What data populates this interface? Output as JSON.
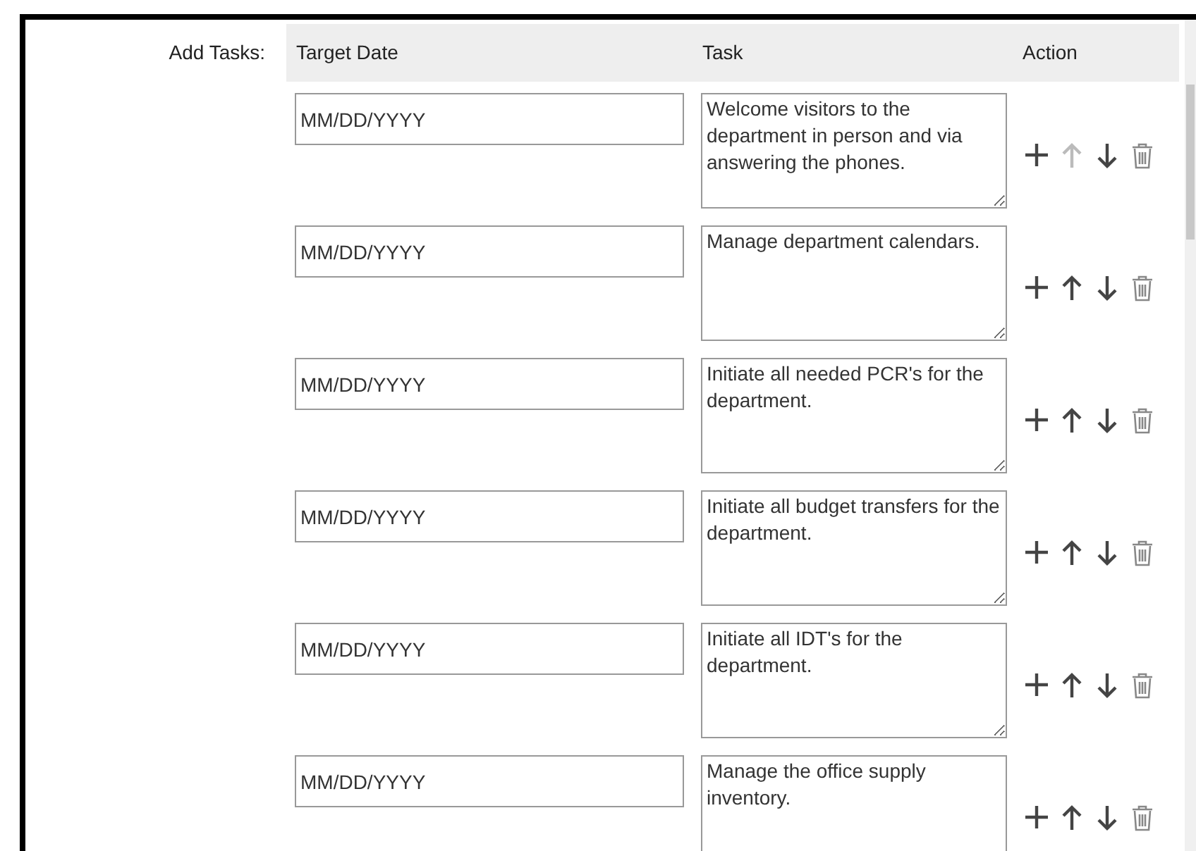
{
  "form_label": "Add Tasks:",
  "columns": [
    "Target Date",
    "Task",
    "Action"
  ],
  "rows": [
    {
      "date_placeholder": "MM/DD/YYYY",
      "task": "Welcome visitors to the department in person and via answering the phones.",
      "move_up_disabled": true
    },
    {
      "date_placeholder": "MM/DD/YYYY",
      "task": "Manage department calendars.",
      "move_up_disabled": false
    },
    {
      "date_placeholder": "MM/DD/YYYY",
      "task": "Initiate all needed PCR's for the department.",
      "move_up_disabled": false
    },
    {
      "date_placeholder": "MM/DD/YYYY",
      "task": "Initiate all budget transfers for the department.",
      "move_up_disabled": false
    },
    {
      "date_placeholder": "MM/DD/YYYY",
      "task": "Initiate all IDT's for the department.",
      "move_up_disabled": false
    },
    {
      "date_placeholder": "MM/DD/YYYY",
      "task": "Manage the office supply inventory.",
      "move_up_disabled": false
    }
  ]
}
